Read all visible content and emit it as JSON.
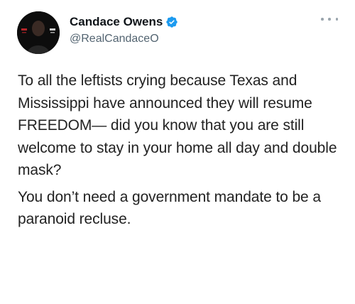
{
  "author": {
    "display_name": "Candace Owens",
    "handle": "@RealCandaceO",
    "verified": true,
    "avatar_icon": "profile-avatar",
    "verified_icon": "verified-badge-icon"
  },
  "menu": {
    "icon": "more-options-icon"
  },
  "tweet": {
    "paragraphs": [
      "To all the leftists crying because Texas and Mississippi have announced they will resume FREEDOM— did you know that you are still welcome to stay in your home all day and double mask?",
      "You don’t need a government mandate to be a paranoid recluse."
    ]
  },
  "colors": {
    "verified_blue": "#1d9bf0",
    "text_primary": "#0f1419",
    "text_secondary": "#536471",
    "background": "#ffffff"
  }
}
